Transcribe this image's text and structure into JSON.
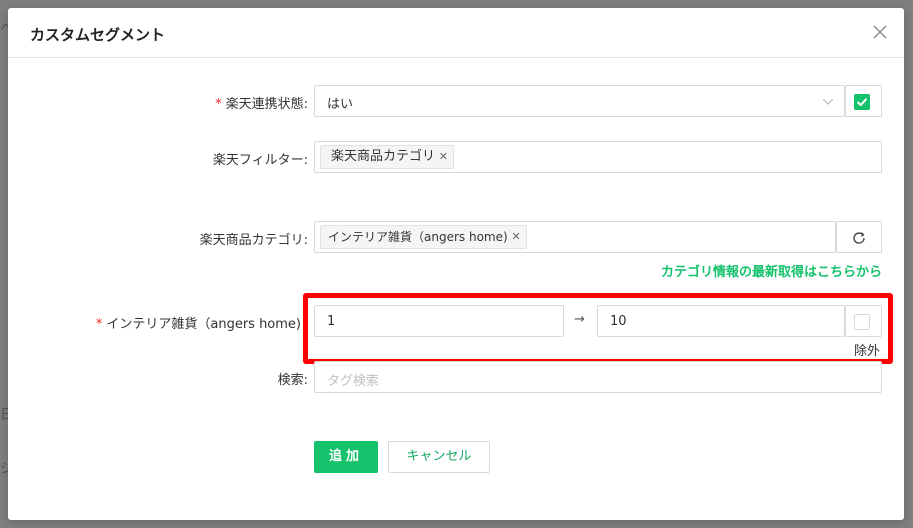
{
  "backdrop": {
    "left_char_1": "ヘ",
    "left_char_2": "日",
    "left_char_3": "ジ"
  },
  "modal": {
    "title": "カスタムセグメント"
  },
  "form": {
    "rakuten_link": {
      "label": "楽天連携状態:",
      "required_mark": "*",
      "value": "はい",
      "checked": true
    },
    "rakuten_filter": {
      "label": "楽天フィルター:",
      "tags": [
        "楽天商品カテゴリ"
      ]
    },
    "product_category": {
      "label": "楽天商品カテゴリ:",
      "tags": [
        "インテリア雑貨（angers home)"
      ],
      "latest_link": "カテゴリ情報の最新取得はこちらから"
    },
    "interior_range": {
      "label": "インテリア雑貨（angers home)",
      "required_mark": "*",
      "from": "1",
      "separator": "→",
      "to": "10",
      "exclude_label": "除外",
      "exclude_checked": false
    },
    "search": {
      "label": "検索:",
      "placeholder": "タグ検索"
    }
  },
  "actions": {
    "add_label": "追加",
    "cancel_label": "キャンセル"
  },
  "colors": {
    "accent": "#13c26b",
    "highlight": "#ff0000",
    "required": "#f5222d"
  }
}
